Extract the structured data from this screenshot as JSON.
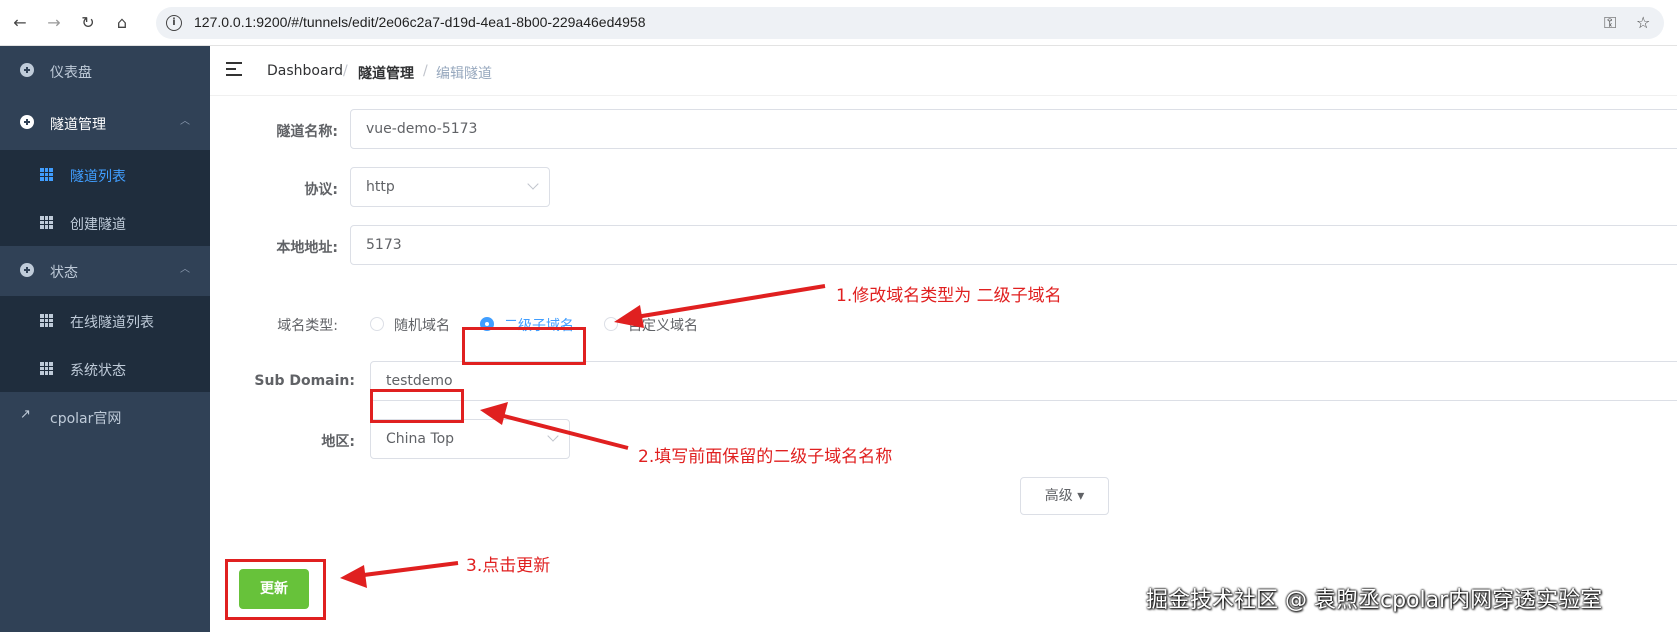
{
  "browser": {
    "url": "127.0.0.1:9200/#/tunnels/edit/2e06c2a7-d19d-4ea1-8b00-229a46ed4958",
    "icons": [
      "back-icon",
      "forward-icon",
      "reload-icon",
      "home-icon",
      "info-icon",
      "key-icon",
      "star-icon"
    ]
  },
  "sidebar": {
    "dashboard": "仪表盘",
    "tunnel_mgmt": "隧道管理",
    "tunnel_list": "隧道列表",
    "create_tunnel": "创建隧道",
    "status": "状态",
    "online_tunnels": "在线隧道列表",
    "system_status": "系统状态",
    "cpolar_site": "cpolar官网"
  },
  "breadcrumb": {
    "home": "Dashboard",
    "section": "隧道管理",
    "current": "编辑隧道",
    "separator": "/"
  },
  "form": {
    "name_label": "隧道名称:",
    "name_value": "vue-demo-5173",
    "protocol_label": "协议:",
    "protocol_value": "http",
    "local_label": "本地地址:",
    "local_value": "5173",
    "domain_type_label": "域名类型:",
    "domain_options": [
      "随机域名",
      "二级子域名",
      "自定义域名"
    ],
    "domain_selected": "二级子域名",
    "subdomain_label": "Sub Domain:",
    "subdomain_value": "testdemo",
    "region_label": "地区:",
    "region_value": "China Top",
    "advanced_button": "高级 ▾",
    "update_button": "更新"
  },
  "annotations": {
    "step1": "1.修改域名类型为 二级子域名",
    "step2": "2.填写前面保留的二级子域名名称",
    "step3": "3.点击更新"
  },
  "watermark": "掘金技术社区 @ 袁煦丞cpolar内网穿透实验室",
  "colors": {
    "sidebar_bg": "#304156",
    "submenu_bg": "#1f2d3d",
    "active_blue": "#409eff",
    "update_green": "#67c23a",
    "annotation_red": "#e02020"
  }
}
